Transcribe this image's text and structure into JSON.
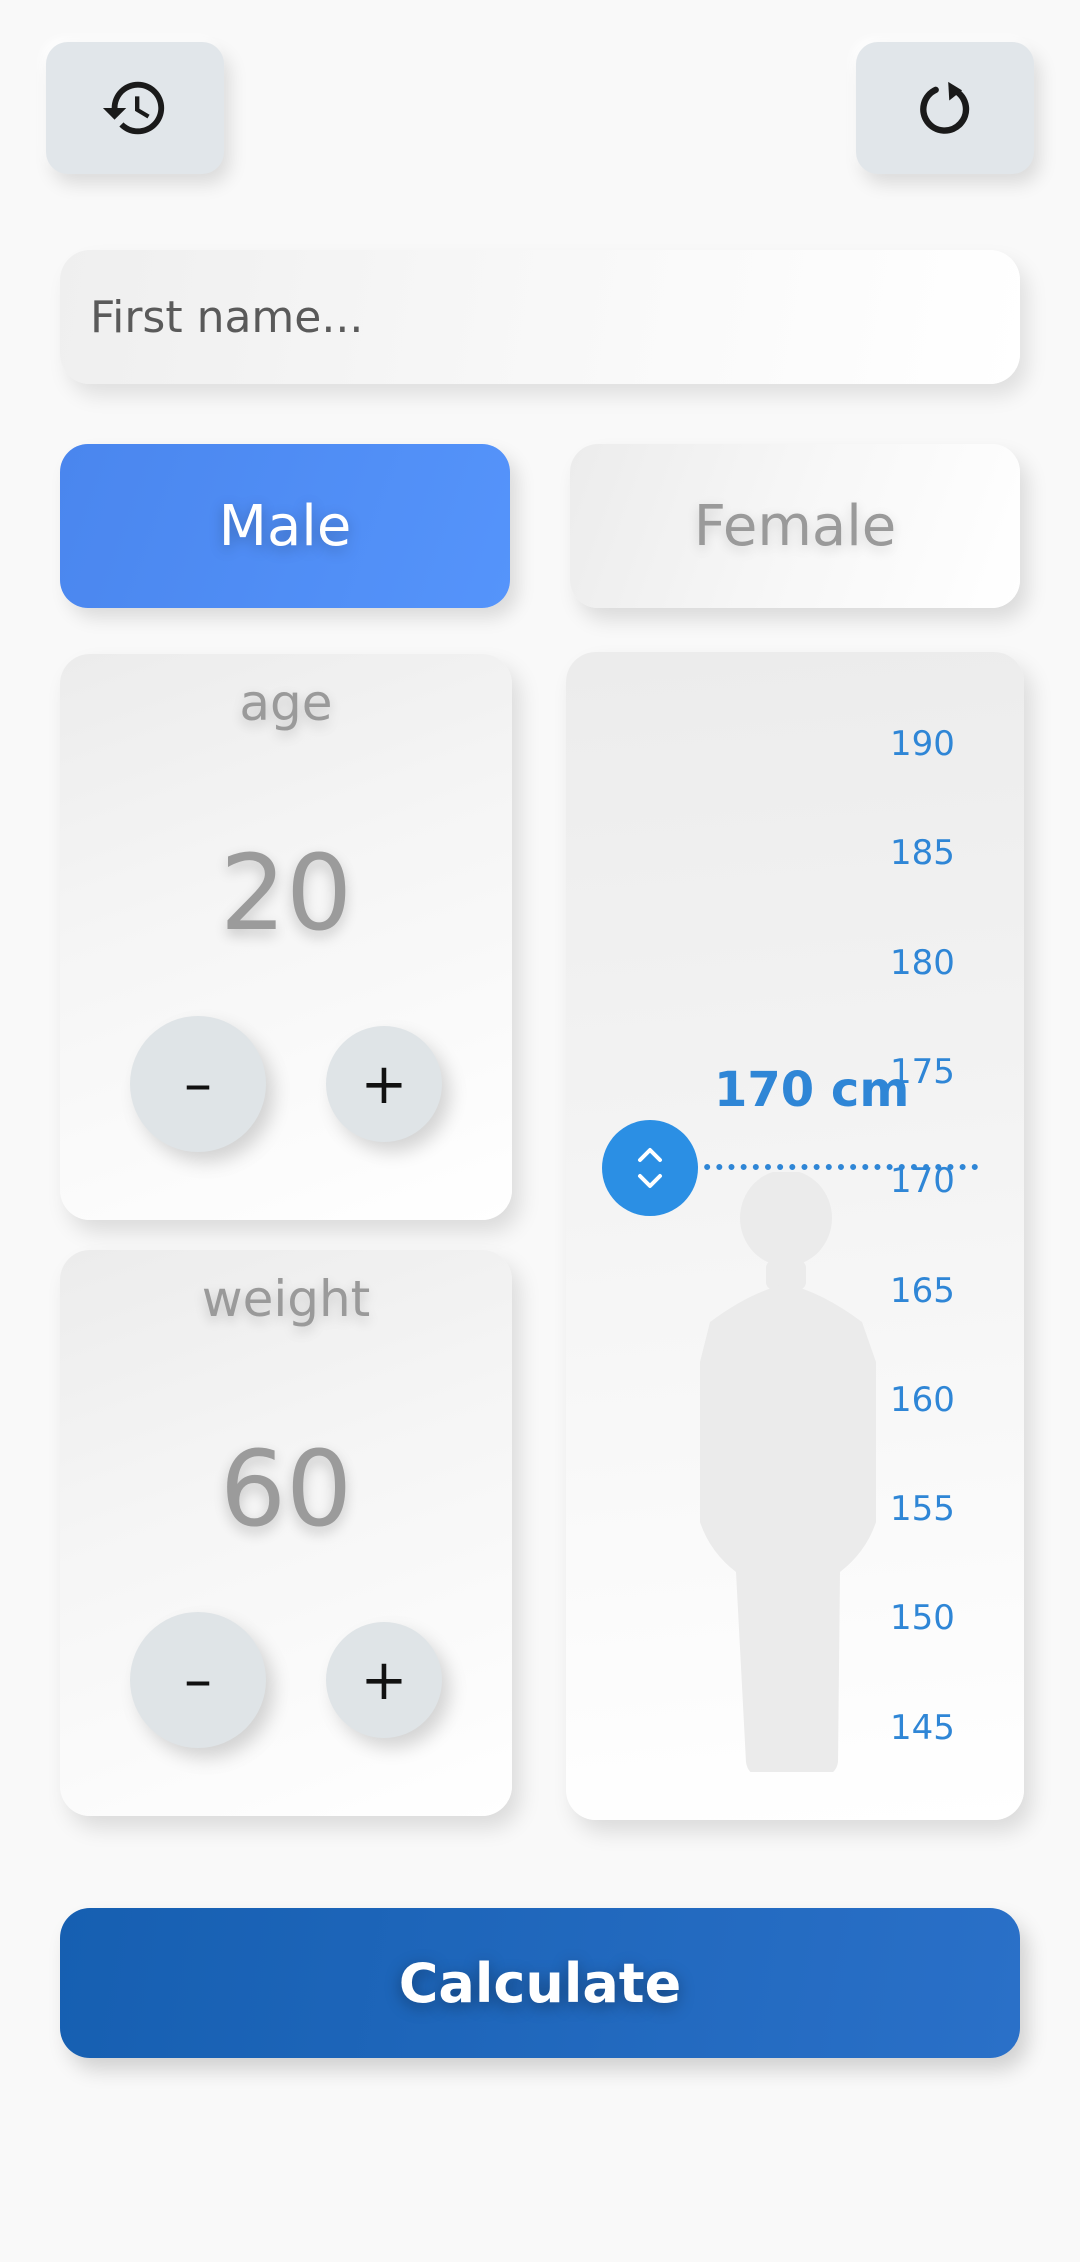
{
  "toolbar": {
    "history_icon": "history-icon",
    "reset_icon": "reset-icon"
  },
  "name_input": {
    "placeholder": "First name...",
    "value": ""
  },
  "gender": {
    "male_label": "Male",
    "female_label": "Female",
    "selected": "Male"
  },
  "age": {
    "title": "age",
    "value": "20",
    "minus_label": "–",
    "plus_label": "+"
  },
  "weight": {
    "title": "weight",
    "value": "60",
    "minus_label": "–",
    "plus_label": "+"
  },
  "height": {
    "readout": "170 cm",
    "value": 170,
    "unit": "cm",
    "ticks": [
      "190",
      "185",
      "180",
      "175",
      "170",
      "165",
      "160",
      "155",
      "150",
      "145"
    ],
    "handle_icon": "unfold-arrows-icon",
    "figure_icon": "person-silhouette-icon"
  },
  "calculate_label": "Calculate",
  "colors": {
    "accent": "#2f86d6",
    "male_selected": "#4a86ee",
    "calculate": "#1c66bd",
    "button_gray": "#e1e6ea"
  }
}
